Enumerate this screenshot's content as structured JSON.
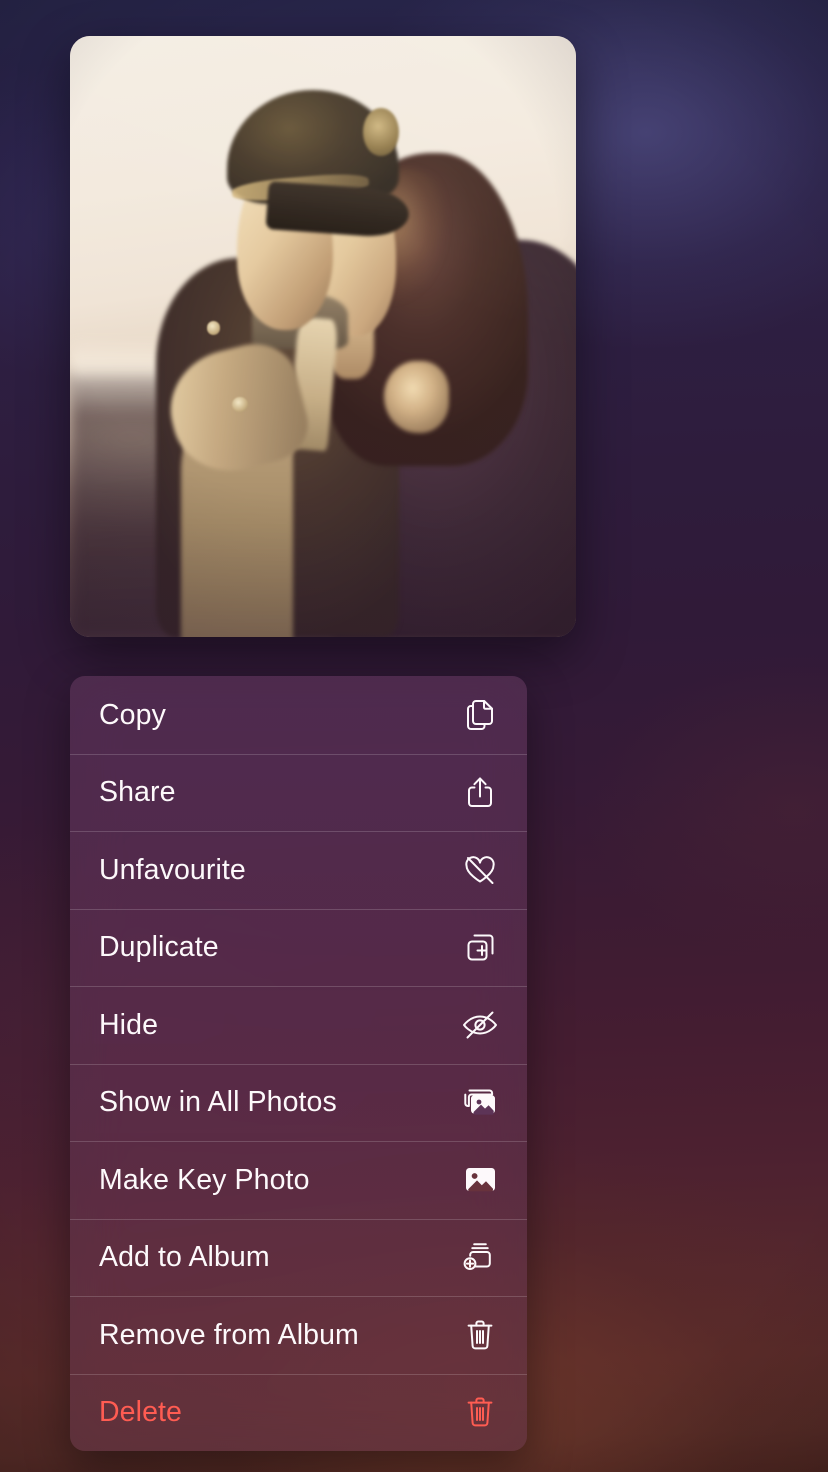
{
  "wallpaper": {
    "description": "blurred dark gradient wallpaper",
    "top_color": "#272549",
    "mid_color": "#301a38",
    "bottom_color": "#55272d"
  },
  "preview": {
    "photo_name": "photo-preview",
    "alt": "Vintage-toned photo of a uniformed soldier wearing a peaked cap embracing a woman with long dark wavy hair, sunlit washed-out sky behind them"
  },
  "context_menu": {
    "accent_destructive": "#ff5c52",
    "label_color": "#fdf9fb",
    "items": [
      {
        "label": "Copy",
        "icon": "copy-icon",
        "destructive": false
      },
      {
        "label": "Share",
        "icon": "share-icon",
        "destructive": false
      },
      {
        "label": "Unfavourite",
        "icon": "heart-slash-icon",
        "destructive": false
      },
      {
        "label": "Duplicate",
        "icon": "duplicate-plus-icon",
        "destructive": false
      },
      {
        "label": "Hide",
        "icon": "eye-slash-icon",
        "destructive": false
      },
      {
        "label": "Show in All Photos",
        "icon": "photo-stack-icon",
        "destructive": false
      },
      {
        "label": "Make Key Photo",
        "icon": "photo-icon",
        "destructive": false
      },
      {
        "label": "Add to Album",
        "icon": "album-plus-icon",
        "destructive": false
      },
      {
        "label": "Remove from Album",
        "icon": "trash-icon",
        "destructive": false
      },
      {
        "label": "Delete",
        "icon": "trash-icon",
        "destructive": true
      }
    ]
  }
}
